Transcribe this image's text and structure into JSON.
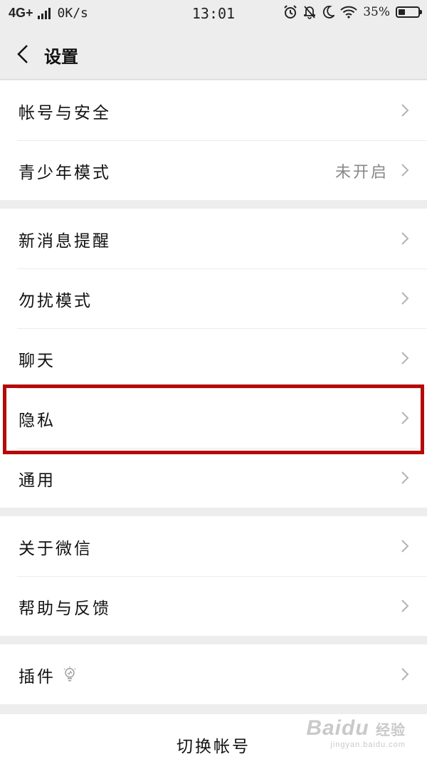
{
  "status_bar": {
    "network": "4G+",
    "speed": "0K/s",
    "time": "13:01",
    "battery_percent": "35%",
    "battery_level": 0.35,
    "icons": [
      "alarm-icon",
      "bell-off-icon",
      "moon-icon",
      "wifi-icon",
      "battery-icon"
    ]
  },
  "header": {
    "title": "设置",
    "back_icon": "back-arrow-icon"
  },
  "sections": [
    {
      "items": [
        {
          "label": "帐号与安全",
          "value": ""
        },
        {
          "label": "青少年模式",
          "value": "未开启"
        }
      ]
    },
    {
      "items": [
        {
          "label": "新消息提醒",
          "value": ""
        },
        {
          "label": "勿扰模式",
          "value": ""
        },
        {
          "label": "聊天",
          "value": ""
        },
        {
          "label": "隐私",
          "value": "",
          "highlighted": true
        },
        {
          "label": "通用",
          "value": ""
        }
      ]
    },
    {
      "items": [
        {
          "label": "关于微信",
          "value": ""
        },
        {
          "label": "帮助与反馈",
          "value": ""
        }
      ]
    },
    {
      "items": [
        {
          "label": "插件",
          "value": "",
          "icon": "lightbulb-icon"
        }
      ]
    }
  ],
  "bottom": {
    "switch_account": "切换帐号"
  },
  "watermark": {
    "logo": "Baidu",
    "sub": "经验",
    "url": "jingyan.baidu.com"
  },
  "colors": {
    "background": "#ededed",
    "highlight": "#b50a0a",
    "secondary_text": "#888888"
  }
}
